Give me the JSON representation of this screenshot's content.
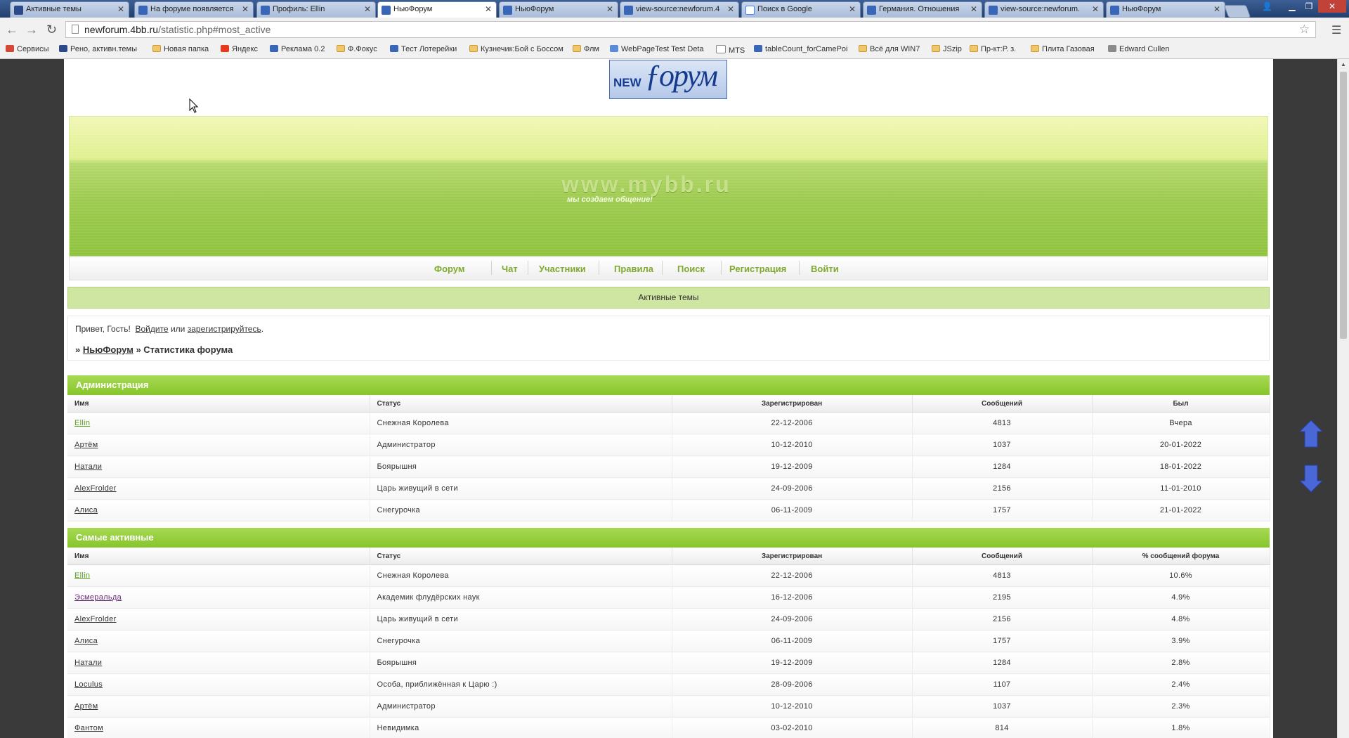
{
  "browser": {
    "tabs": [
      {
        "title": "Активные темы",
        "color": "#2c4a8a",
        "icon": "photoshop-icon"
      },
      {
        "title": "На форуме появляется",
        "color": "#3a66b8",
        "icon": "forum-icon"
      },
      {
        "title": "Профиль: Ellin",
        "color": "#3a66b8",
        "icon": "forum-icon"
      },
      {
        "title": "НьюФорум",
        "color": "#3a66b8",
        "icon": "forum-icon"
      },
      {
        "title": "НьюФорум",
        "color": "#3a66b8",
        "icon": "forum-icon"
      },
      {
        "title": "view-source:newforum.4",
        "color": "#3a66b8",
        "icon": "forum-icon"
      },
      {
        "title": "Поиск в Google",
        "color": "#ffffff",
        "icon": "google-icon"
      },
      {
        "title": "Германия. Отношения",
        "color": "#3a66b8",
        "icon": "forum-icon"
      },
      {
        "title": "view-source:newforum.",
        "color": "#3a66b8",
        "icon": "forum-icon"
      },
      {
        "title": "НьюФорум",
        "color": "#3a66b8",
        "icon": "forum-icon"
      }
    ],
    "url_host": "newforum.4bb.ru",
    "url_path": "/statistic.php#most_active",
    "bookmarks": [
      {
        "label": "Сервисы",
        "icon": "apps-icon"
      },
      {
        "label": "Рено, активн.темы",
        "icon": "photoshop-icon"
      },
      {
        "label": "Новая папка",
        "icon": "folder-icon"
      },
      {
        "label": "Яндекс",
        "icon": "yandex-icon"
      },
      {
        "label": "Реклама 0.2",
        "icon": "forum-icon"
      },
      {
        "label": "Ф.Фокус",
        "icon": "folder-icon"
      },
      {
        "label": "Тест Лотерейки",
        "icon": "forum-icon"
      },
      {
        "label": "Кузнечик:Бой с Боссом",
        "icon": "folder-icon"
      },
      {
        "label": "Флм",
        "icon": "folder-icon"
      },
      {
        "label": "WebPageTest Test Deta",
        "icon": "webpagetest-icon"
      },
      {
        "label": "MTS",
        "icon": "page-icon"
      },
      {
        "label": "tableCount_forCamePoi",
        "icon": "forum-icon"
      },
      {
        "label": "Всё для WIN7",
        "icon": "folder-icon"
      },
      {
        "label": "JSzip",
        "icon": "folder-icon"
      },
      {
        "label": "Пр-кт:Р. з.",
        "icon": "folder-icon"
      },
      {
        "label": "Плита Газовая",
        "icon": "folder-icon"
      },
      {
        "label": "Edward Cullen",
        "icon": "book-icon"
      }
    ]
  },
  "logo": {
    "new": "NEW",
    "main": "ƒорум"
  },
  "banner": {
    "site": "www.mybb.ru",
    "slogan": "мы создаем общение!"
  },
  "nav": [
    "Форум",
    "Чат",
    "Участники",
    "Правила",
    "Поиск",
    "Регистрация",
    "Войти"
  ],
  "announcement": "Активные темы",
  "welcome": {
    "greeting_prefix": "Привет, Гость!",
    "login_link": "Войдите",
    "or": "или",
    "register_link": "зарегистрируйтесь",
    "period": "."
  },
  "breadcrumb": {
    "sep": "»",
    "home": "НьюФорум",
    "current": "» Статистика форума"
  },
  "admins": {
    "title": "Администрация",
    "columns": [
      "Имя",
      "Статус",
      "Зарегистрирован",
      "Сообщений",
      "Был"
    ],
    "rows": [
      {
        "name": "Ellin",
        "status": "Снежная Королева",
        "registered": "22-12-2006",
        "posts": "4813",
        "last": "Вчера",
        "style": "admin"
      },
      {
        "name": "Артём",
        "status": "Администратор",
        "registered": "10-12-2010",
        "posts": "1037",
        "last": "20-01-2022",
        "style": ""
      },
      {
        "name": "Натали",
        "status": "Боярышня",
        "registered": "19-12-2009",
        "posts": "1284",
        "last": "18-01-2022",
        "style": ""
      },
      {
        "name": "AlexFrolder",
        "status": "Царь живущий в сети",
        "registered": "24-09-2006",
        "posts": "2156",
        "last": "11-01-2010",
        "style": ""
      },
      {
        "name": "Алиса",
        "status": "Снегурочка",
        "registered": "06-11-2009",
        "posts": "1757",
        "last": "21-01-2022",
        "style": ""
      }
    ]
  },
  "active": {
    "title": "Самые активные",
    "columns": [
      "Имя",
      "Статус",
      "Зарегистрирован",
      "Сообщений",
      "% сообщений форума"
    ],
    "rows": [
      {
        "name": "Ellin",
        "status": "Снежная Королева",
        "registered": "22-12-2006",
        "posts": "4813",
        "percent": "10.6%",
        "style": "admin"
      },
      {
        "name": "Эсмеральда",
        "status": "Академик флудёрских наук",
        "registered": "16-12-2006",
        "posts": "2195",
        "percent": "4.9%",
        "style": "purple"
      },
      {
        "name": "AlexFrolder",
        "status": "Царь живущий в сети",
        "registered": "24-09-2006",
        "posts": "2156",
        "percent": "4.8%",
        "style": ""
      },
      {
        "name": "Алиса",
        "status": "Снегурочка",
        "registered": "06-11-2009",
        "posts": "1757",
        "percent": "3.9%",
        "style": ""
      },
      {
        "name": "Натали",
        "status": "Боярышня",
        "registered": "19-12-2009",
        "posts": "1284",
        "percent": "2.8%",
        "style": ""
      },
      {
        "name": "Loculus",
        "status": "Особа, приближённая к Царю :)",
        "registered": "28-09-2006",
        "posts": "1107",
        "percent": "2.4%",
        "style": ""
      },
      {
        "name": "Артём",
        "status": "Администратор",
        "registered": "10-12-2010",
        "posts": "1037",
        "percent": "2.3%",
        "style": ""
      },
      {
        "name": "Фантом",
        "status": "Невидимка",
        "registered": "03-02-2010",
        "posts": "814",
        "percent": "1.8%",
        "style": ""
      }
    ]
  },
  "colors": {
    "accent_green": "#86c52a",
    "nav_green": "#7fa92f",
    "arrow_blue": "#4a67d8"
  }
}
